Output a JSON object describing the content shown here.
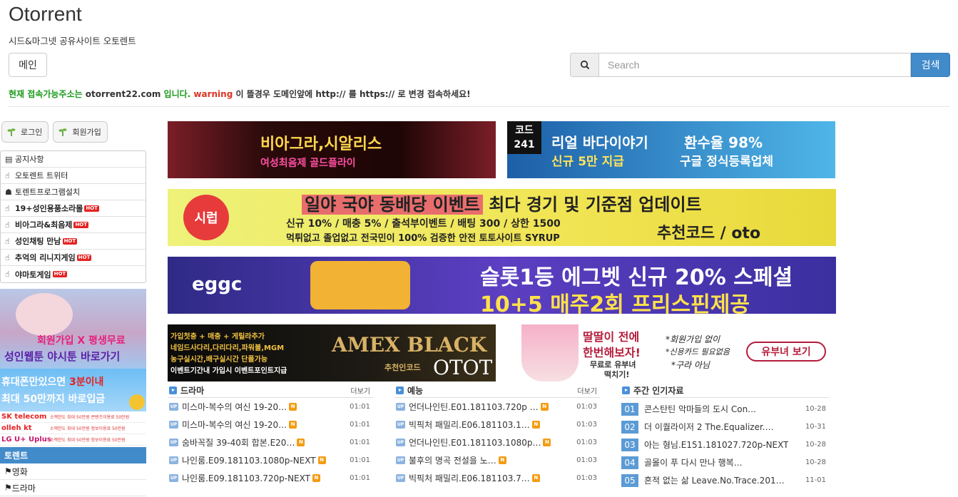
{
  "header": {
    "title": "Otorrent",
    "subtitle": "시드&마그넷 공유사이트 오토렌트",
    "main_button": "메인",
    "search_placeholder": "Search",
    "search_button": "검색"
  },
  "notice": {
    "part1": "현재 접속가능주소는",
    "domain": "otorrent22.com",
    "part2": "입니다.",
    "warning": "warning",
    "part3": "이 뜰경우 도메인앞에",
    "http": "http://",
    "part4": "를",
    "https": "https://",
    "part5": "로 변경 접속하세요!"
  },
  "sidebar": {
    "login": "로그인",
    "join": "회원가입",
    "menu": [
      {
        "label": "공지사항",
        "icon": "list-icon",
        "hot": false,
        "bold": false
      },
      {
        "label": "오토렌트 트위터",
        "icon": "thumb-icon",
        "hot": false,
        "bold": false
      },
      {
        "label": "토렌트프로그램설치",
        "icon": "download-icon",
        "hot": false,
        "bold": false
      },
      {
        "label": "19+성인용품소라몰",
        "icon": "thumb-icon",
        "hot": true,
        "bold": true
      },
      {
        "label": "비아그라&최음제",
        "icon": "thumb-icon",
        "hot": true,
        "bold": true
      },
      {
        "label": "성인채팅 만남",
        "icon": "thumb-icon",
        "hot": true,
        "bold": true
      },
      {
        "label": "추억의 리니지게임",
        "icon": "thumb-icon",
        "hot": true,
        "bold": true
      },
      {
        "label": "야마토게임",
        "icon": "thumb-icon",
        "hot": true,
        "bold": true
      }
    ],
    "hot_label": "HOT",
    "ad1_line1": "회원가입 X 평생무료",
    "ad1_line2": "성인웹툰 야시툰 바로가기",
    "ad2_line1_a": "휴대폰만있으면",
    "ad2_line1_b": "3분이내",
    "ad2_line2": "최대 50만까지 바로입금",
    "carriers": [
      {
        "name": "SK telecom",
        "fine": "소액한도 최대 50만원 콘텐츠이용료 50만원",
        "color": "#e52222"
      },
      {
        "name": "olleh kt",
        "fine": "소액한도 최대 50만원 정보이용료 50만원",
        "color": "#e52222"
      },
      {
        "name": "LG U+ Uplus",
        "fine": "소액한도 최대 50만원 정보이용료 50만원",
        "color": "#c4176c"
      }
    ],
    "section_active": "토렌트",
    "section_items": [
      "영화",
      "드라마"
    ]
  },
  "banners": {
    "b1_line1": "비아그라,시알리스",
    "b1_line2": "여성최음제 골드플라이",
    "b2_code_a": "코드",
    "b2_code_b": "241",
    "b2_line1": "리얼 바다이야기",
    "b2_line2": "신규 5만 지급",
    "b2_right1": "환수율 98%",
    "b2_right2": "구글 정식등록업체",
    "b3_logo": "시럽",
    "b3_line1_hl": "일야 국야 동배당 이벤트",
    "b3_line1_rest": "최다 경기 및 기준점 업데이트",
    "b3_line2": "신규 10% / 매충 5% / 출석부이벤트 / 배팅 300 / 상한 1500",
    "b3_line3": "먹튀없고 졸업없고 전국민이 100% 검증한 안전 토토사이트 SYRUP",
    "b3_code": "추천코드 / oto",
    "b4_logo": "eggc",
    "b4_line1": "슬롯1등 에그벳 신규 20% 스페셜",
    "b4_line2": "10+5 매주2회 프리스핀제공",
    "b5_lines": [
      "가입첫충 + 매충 + 게릴라추가",
      "네임드사다리,다리다리,파워볼,MGM",
      "농구실시간,배구실시간 단폴가능",
      "이벤트기간내 가입시 이벤트포인트지급"
    ],
    "b5_amex": "AMEX BLACK",
    "b5_code": "추천인코드",
    "b5_otot": "OTOT",
    "b6_line1": "딸딸이 전에",
    "b6_line2": "한번해보자!",
    "b6_line3": "무료로 유부녀",
    "b6_line4": "떡치기!",
    "b6_bullet1": "*회원가입 없이",
    "b6_bullet2": "*신용카드 필요없음",
    "b6_bullet3": "*구라 아님",
    "b6_button": "유부녀 보기"
  },
  "lists": {
    "more": "더보기",
    "up_badge": "UP",
    "n_badge": "N",
    "drama": {
      "title": "드라마",
      "rows": [
        {
          "title": "미스마-복수의 여신 19-20…",
          "date": "01:01"
        },
        {
          "title": "미스마-복수의 여신 19-20…",
          "date": "01:01"
        },
        {
          "title": "숨바꼭질 39-40회 합본.E20…",
          "date": "01:01"
        },
        {
          "title": "나인룸.E09.181103.1080p-NEXT",
          "date": "01:01"
        },
        {
          "title": "나인룸.E09.181103.720p-NEXT",
          "date": "01:01"
        }
      ]
    },
    "variety": {
      "title": "예능",
      "rows": [
        {
          "title": "언더나인틴.E01.181103.720p …",
          "date": "01:03"
        },
        {
          "title": "빅픽처 패밀리.E06.181103.1…",
          "date": "01:03"
        },
        {
          "title": "언더나인틴.E01.181103.1080p…",
          "date": "01:03"
        },
        {
          "title": "불후의 명곡 전설을 노…",
          "date": "01:03"
        },
        {
          "title": "빅픽처 패밀리.E06.181103.7…",
          "date": "01:03"
        }
      ]
    },
    "weekly": {
      "title": "주간 인기자료",
      "rows": [
        {
          "rank": "01",
          "title": "콘스탄틴 악마들의 도시 Con…",
          "date": "10-28"
        },
        {
          "rank": "02",
          "title": "더 이퀄라이저 2 The.Equalizer.…",
          "date": "10-31"
        },
        {
          "rank": "03",
          "title": "아는 형님.E151.181027.720p-NEXT",
          "date": "10-28"
        },
        {
          "rank": "04",
          "title": "골몰이 푸 다시 만나 행복…",
          "date": "10-28"
        },
        {
          "rank": "05",
          "title": "흔적 없는 삶 Leave.No.Trace.201…",
          "date": "11-01"
        }
      ]
    }
  }
}
